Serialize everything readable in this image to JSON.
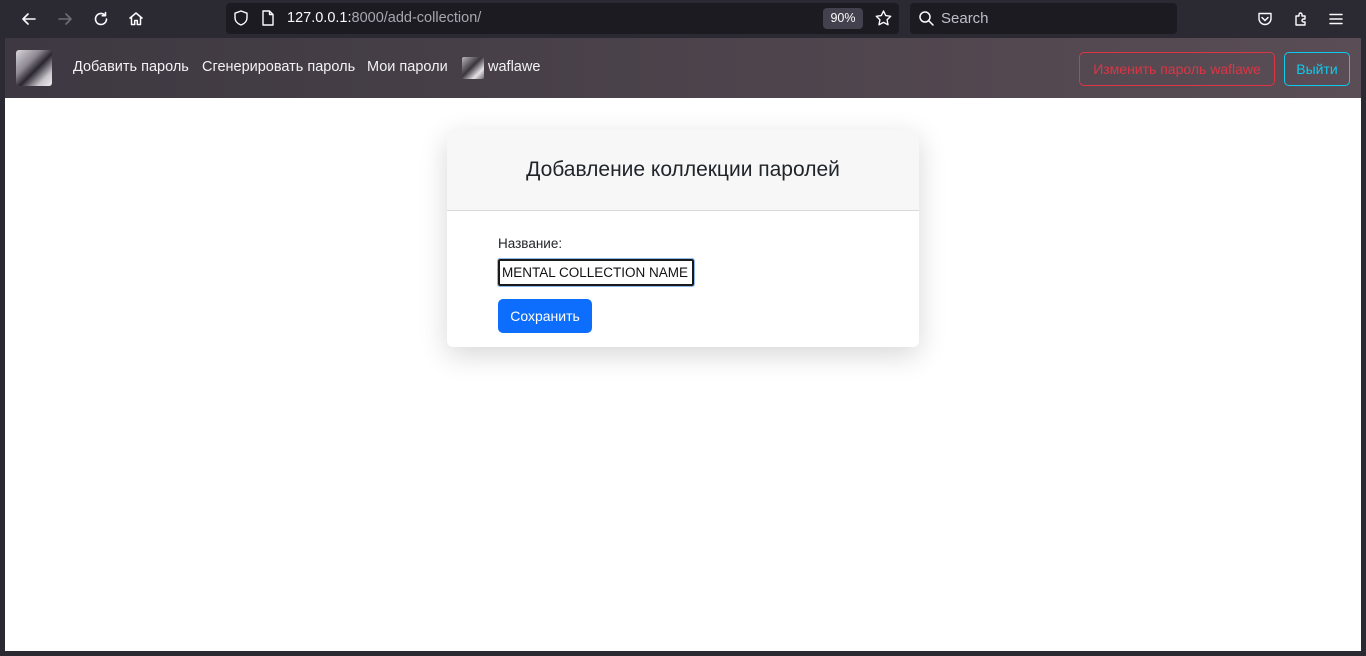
{
  "browser": {
    "url_host": "127.0.0.1:",
    "url_path": "8000/add-collection/",
    "zoom": "90%",
    "search_placeholder": "Search"
  },
  "navbar": {
    "links": [
      "Добавить пароль",
      "Сгенерировать пароль",
      "Мои пароли"
    ],
    "username": "waflawe",
    "change_password_button": "Изменить пароль waflawe",
    "logout_button": "Выйти"
  },
  "card": {
    "title": "Добавление коллекции паролей",
    "name_label": "Название:",
    "name_value": "MENTAL COLLECTION NAME",
    "save_button": "Сохранить"
  },
  "colors": {
    "primary": "#0d6efd",
    "danger": "#dc3545",
    "info": "#0dcaf0"
  }
}
